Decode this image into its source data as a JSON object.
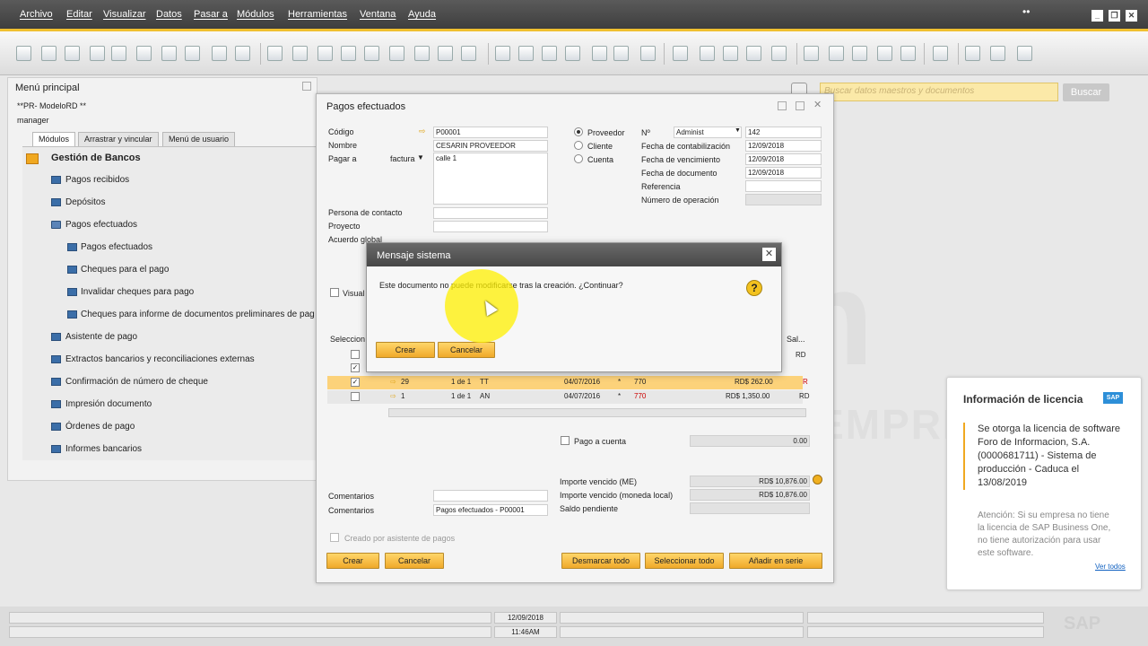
{
  "menubar": {
    "items": [
      "Archivo",
      "Editar",
      "Visualizar",
      "Datos",
      "Pasar a",
      "Módulos",
      "Herramientas",
      "Ventana",
      "Ayuda"
    ]
  },
  "search": {
    "placeholder": "Buscar datos maestros y documentos",
    "button": "Buscar"
  },
  "main_menu": {
    "title": "Menú principal",
    "company": "**PR- ModeloRD **",
    "user": "manager",
    "tabs": [
      "Módulos",
      "Arrastrar y vincular",
      "Menú de usuario"
    ],
    "tree": {
      "header": "Gestión de Bancos",
      "items": [
        "Pagos recibidos",
        "Depósitos",
        "Pagos efectuados"
      ],
      "subitems": [
        "Pagos efectuados",
        "Cheques para el pago",
        "Invalidar cheques para pago",
        "Cheques para informe de documentos preliminares de pag"
      ],
      "more": [
        "Asistente de pago",
        "Extractos bancarios y reconciliaciones externas",
        "Confirmación de número de cheque",
        "Impresión documento",
        "Órdenes de pago",
        "Informes bancarios"
      ]
    }
  },
  "payments": {
    "title": "Pagos efectuados",
    "labels": {
      "codigo": "Código",
      "nombre": "Nombre",
      "pagar_a": "Pagar a",
      "persona": "Persona de contacto",
      "proyecto": "Proyecto",
      "acuerdo": "Acuerdo global",
      "proveedor": "Proveedor",
      "cliente": "Cliente",
      "cuenta": "Cuenta",
      "n": "Nº",
      "fcontab": "Fecha de contabilización",
      "fvenc": "Fecha de vencimiento",
      "fdoc": "Fecha de documento",
      "referencia": "Referencia",
      "numop": "Número de operación",
      "visual": "Visual",
      "seleccion": "Seleccion",
      "sal": "Sal...",
      "pago_cuenta": "Pago a cuenta",
      "comentarios": "Comentarios",
      "importe_me": "Importe vencido (ME)",
      "importe_ml": "Importe vencido (moneda local)",
      "saldo": "Saldo pendiente",
      "creado": "Creado por asistente de pagos"
    },
    "values": {
      "codigo": "P00001",
      "nombre": "CESARIN PROVEEDOR",
      "pagar_a_sel": "factura",
      "direccion": "calle 1",
      "serie": "Administ",
      "numero": "142",
      "fcontab": "12/09/2018",
      "fvenc": "12/09/2018",
      "fdoc": "12/09/2018",
      "pago_cuenta": "0.00",
      "importe_me": "RD$ 10,876.00",
      "importe_ml": "RD$ 10,876.00",
      "comentarios2": "Pagos efectuados - P00001",
      "rd_header": "RD"
    },
    "rows": [
      {
        "doc": "29",
        "cuota": "1 de 1",
        "tipo": "TT",
        "fecha": "04/07/2016",
        "star": "*",
        "dias": "770",
        "total": "RD$ 262.00",
        "r": "R"
      },
      {
        "doc": "1",
        "cuota": "1 de 1",
        "tipo": "AN",
        "fecha": "04/07/2016",
        "star": "*",
        "dias": "770",
        "total": "RD$ 1,350.00",
        "r": "RD"
      }
    ],
    "buttons": {
      "crear": "Crear",
      "cancelar": "Cancelar",
      "desmarcar": "Desmarcar todo",
      "seleccionar": "Seleccionar todo",
      "anadir": "Añadir en serie"
    }
  },
  "dialog": {
    "title": "Mensaje sistema",
    "message": "Este documento no puede modificarse tras la creación. ¿Continuar?",
    "ok": "Crear",
    "cancel": "Cancelar"
  },
  "license": {
    "title": "Información de licencia",
    "badge": "SAP",
    "body": "Se otorga la licencia de software Foro de Informacion, S.A. (0000681711) - Sistema de producción - Caduca el 13/08/2019",
    "warning": "Atención: Si su empresa no tiene la licencia de SAP Business One, no tiene autorización para usar este software.",
    "link": "Ver todos"
  },
  "statusbar": {
    "date": "12/09/2018",
    "time": "11:46AM",
    "logo": "SAP"
  },
  "colors": {
    "accent": "#f0a820",
    "highlight": "#fff000",
    "titlebar": "#474747"
  }
}
